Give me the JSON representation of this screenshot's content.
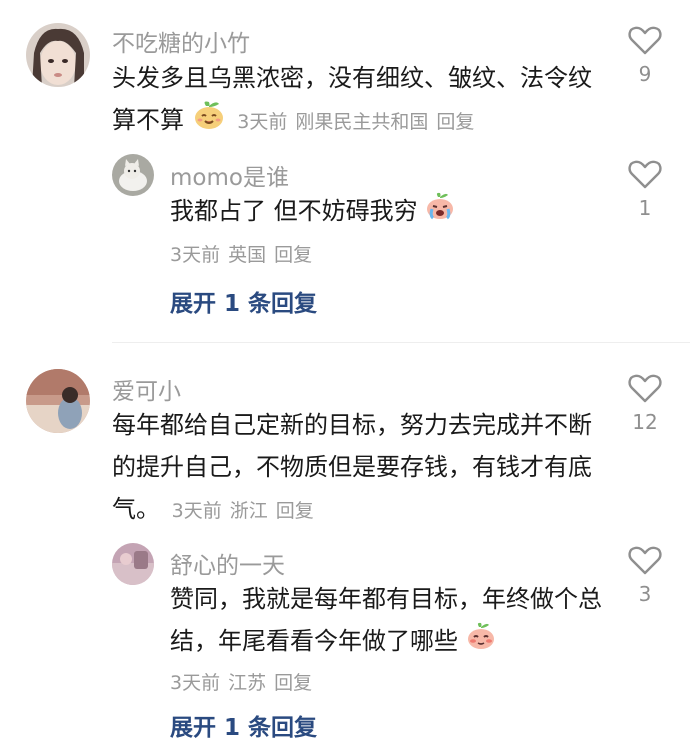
{
  "comments": [
    {
      "user": "不吃糖的小竹",
      "text": "头发多且乌黑浓密，没有细纹、皱纹、法令纹算不算",
      "emoji": "peach-smile-emoji",
      "time": "3天前",
      "location": "刚果民主共和国",
      "reply_label": "回复",
      "likes": "9",
      "reply": {
        "user": "momo是谁",
        "text": "我都占了 但不妨碍我穷",
        "emoji": "peach-cry-emoji",
        "time": "3天前",
        "location": "英国",
        "reply_label": "回复",
        "likes": "1"
      },
      "expand_label": "展开 1 条回复"
    },
    {
      "user": "爱可小",
      "text": "每年都给自己定新的目标，努力去完成并不断的提升自己，不物质但是要存钱，有钱才有底气。",
      "time": "3天前",
      "location": "浙江",
      "reply_label": "回复",
      "likes": "12",
      "reply": {
        "user": "舒心的一天",
        "text": "赞同，我就是每年都有目标，年终做个总结，年尾看看今年做了哪些",
        "emoji": "peach-blush-emoji",
        "time": "3天前",
        "location": "江苏",
        "reply_label": "回复",
        "likes": "3"
      },
      "expand_label": "展开 1 条回复"
    }
  ],
  "colors": {
    "name": "#9a9a9a",
    "text": "#1a1a1a",
    "expand": "#2a4a80",
    "heart": "#8f8f8f"
  }
}
